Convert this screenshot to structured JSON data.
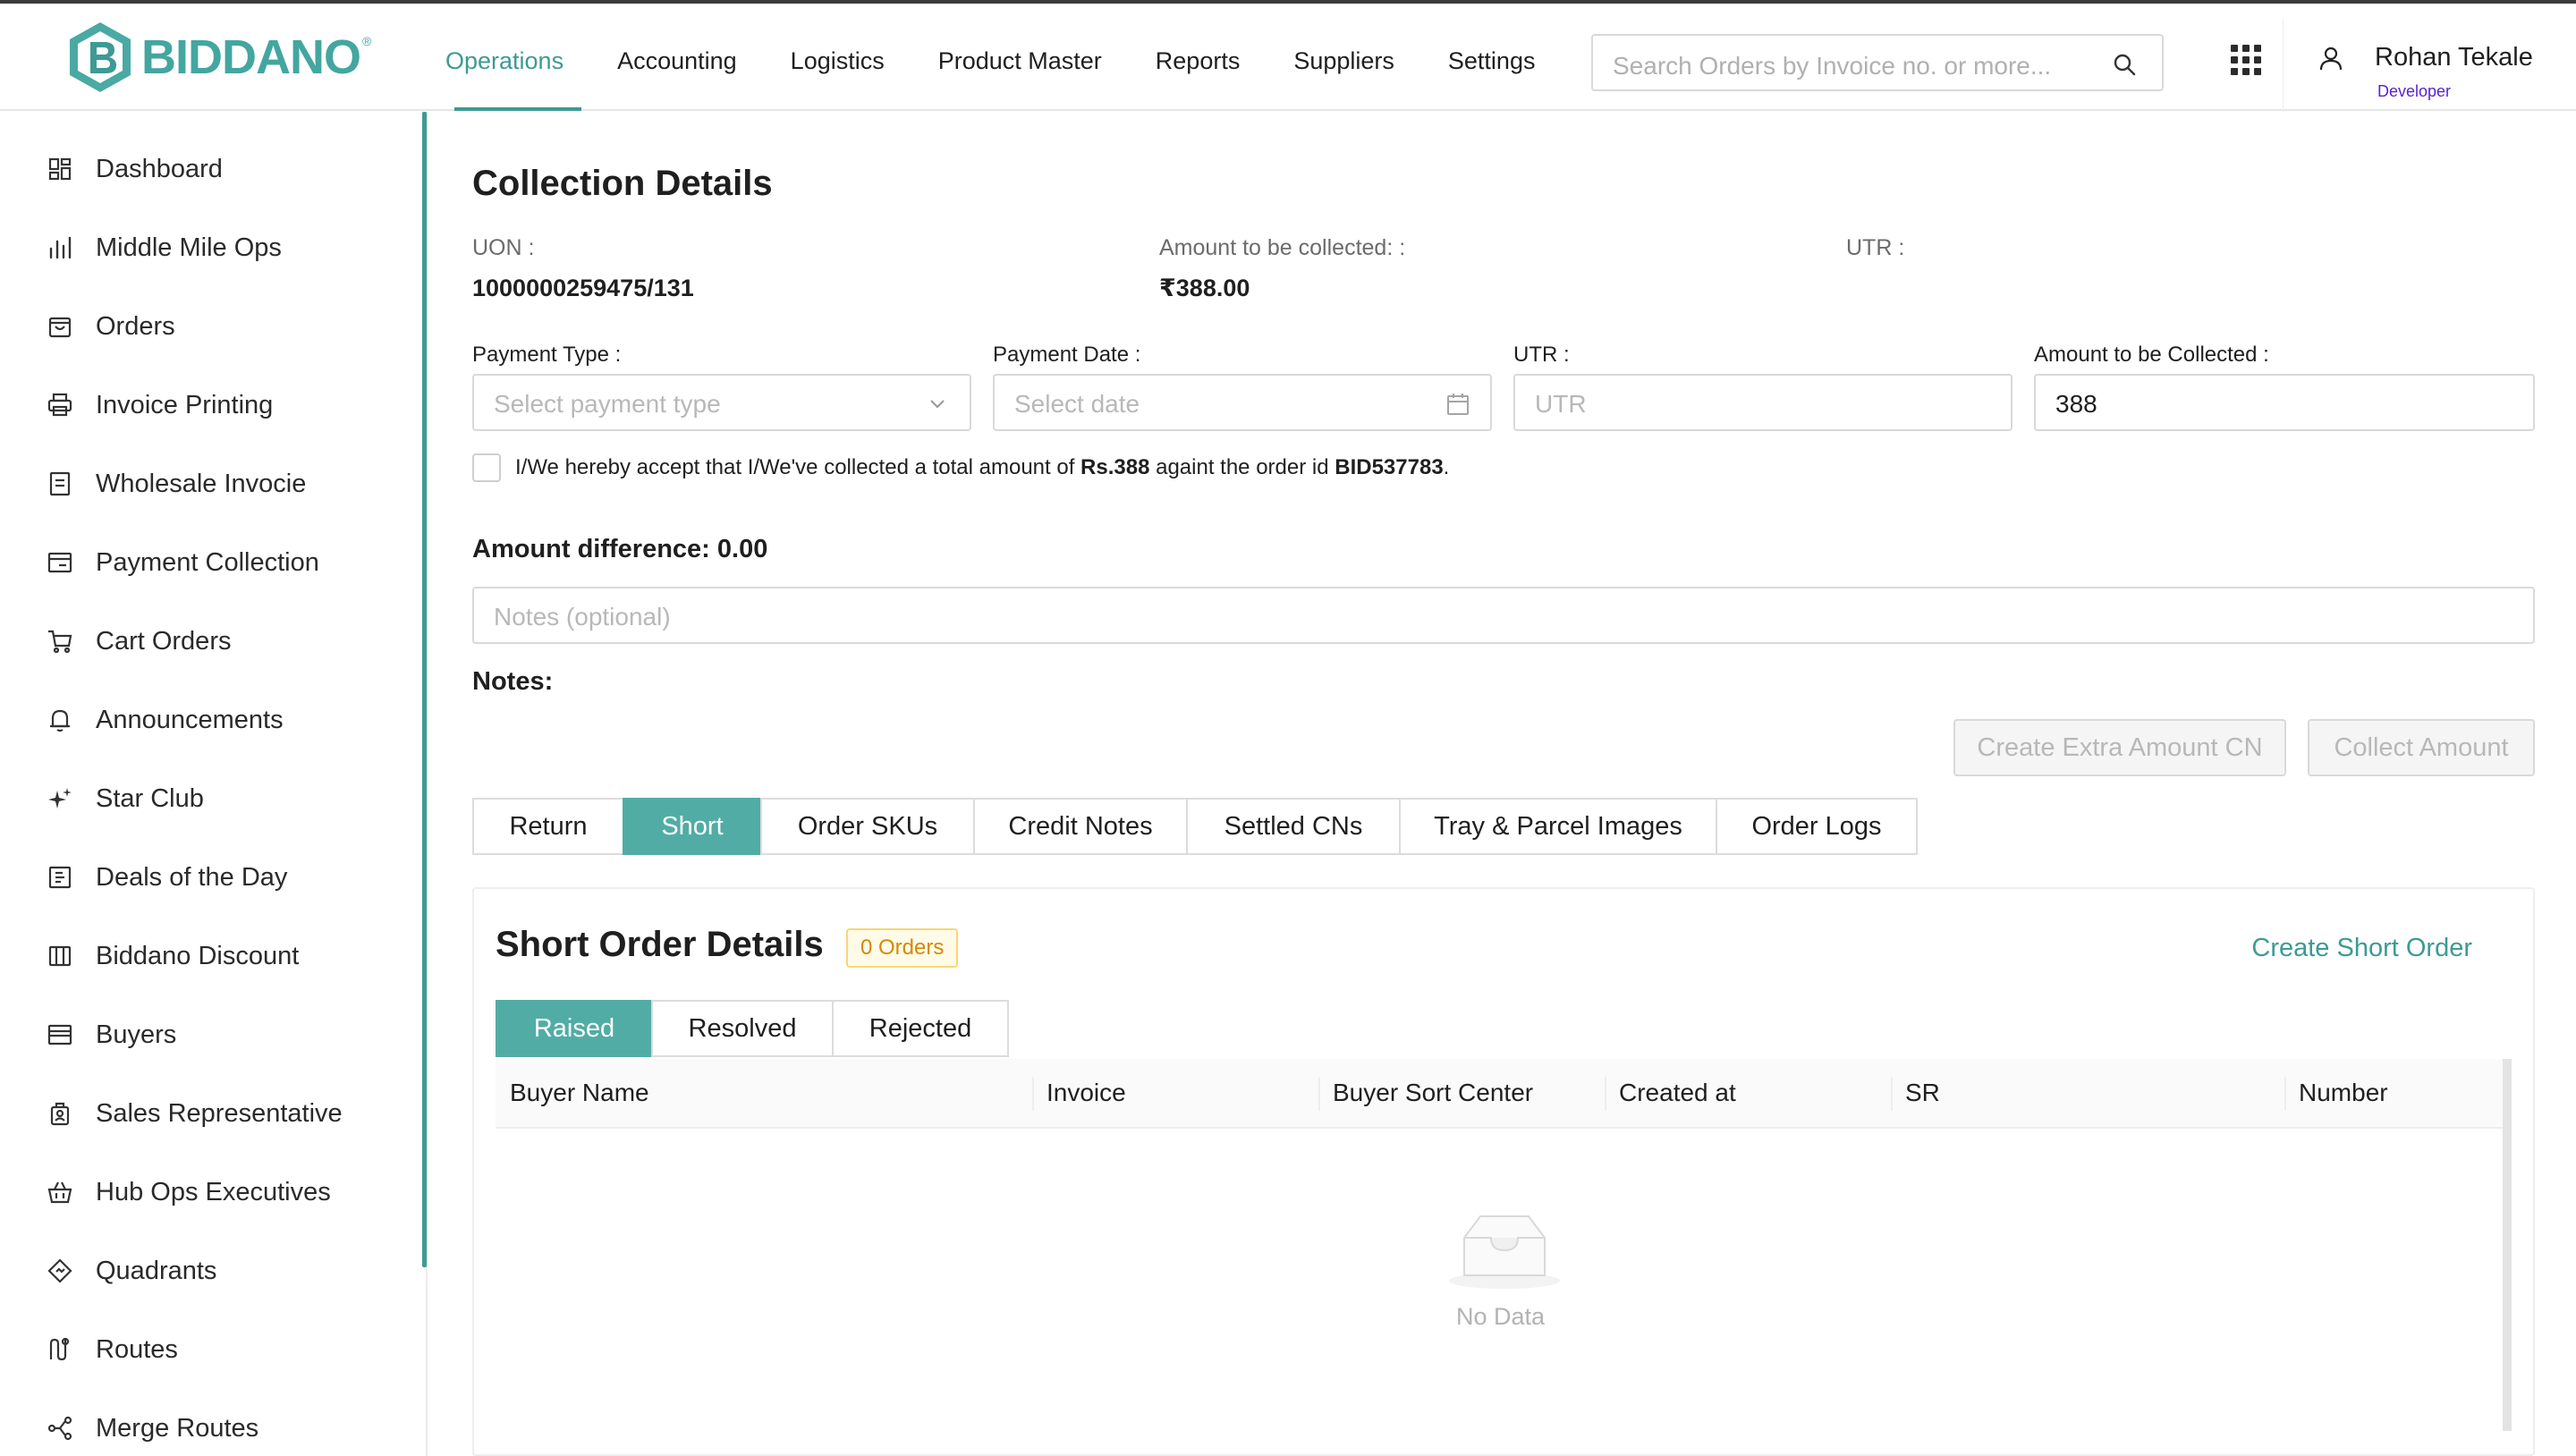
{
  "brand": {
    "name": "BIDDANO",
    "reg": "®"
  },
  "topnav": [
    "Operations",
    "Accounting",
    "Logistics",
    "Product Master",
    "Reports",
    "Suppliers",
    "Settings"
  ],
  "search": {
    "placeholder": "Search Orders by Invoice no. or more..."
  },
  "user": {
    "name": "Rohan Tekale",
    "role": "Developer"
  },
  "sidebar": [
    {
      "label": "Dashboard",
      "icon": "dashboard-icon"
    },
    {
      "label": "Middle Mile Ops",
      "icon": "bar-chart-icon"
    },
    {
      "label": "Orders",
      "icon": "bag-icon"
    },
    {
      "label": "Invoice Printing",
      "icon": "printer-icon"
    },
    {
      "label": "Wholesale Invocie",
      "icon": "document-icon"
    },
    {
      "label": "Payment Collection",
      "icon": "wallet-icon"
    },
    {
      "label": "Cart Orders",
      "icon": "cart-icon"
    },
    {
      "label": "Announcements",
      "icon": "bell-icon"
    },
    {
      "label": "Star Club",
      "icon": "sparkle-icon"
    },
    {
      "label": "Deals of the Day",
      "icon": "deal-icon"
    },
    {
      "label": "Biddano Discount",
      "icon": "discount-icon"
    },
    {
      "label": "Buyers",
      "icon": "store-icon"
    },
    {
      "label": "Sales Representative",
      "icon": "person-badge-icon"
    },
    {
      "label": "Hub Ops Executives",
      "icon": "basket-icon"
    },
    {
      "label": "Quadrants",
      "icon": "diamond-icon"
    },
    {
      "label": "Routes",
      "icon": "route-icon"
    },
    {
      "label": "Merge Routes",
      "icon": "merge-icon"
    }
  ],
  "collection": {
    "title": "Collection Details",
    "uon_label": "UON :",
    "uon_value": "1000000259475/131",
    "amount_label": "Amount to be collected: :",
    "amount_value": "₹388.00",
    "utr_label": "UTR :",
    "payment_type_label": "Payment Type :",
    "payment_type_placeholder": "Select payment type",
    "payment_date_label": "Payment Date :",
    "payment_date_placeholder": "Select date",
    "utr_field_label": "UTR :",
    "utr_placeholder": "UTR",
    "amount_field_label": "Amount to be Collected :",
    "amount_field_value": "388",
    "accept_prefix": "I/We hereby accept that I/We've collected a total amount of ",
    "accept_amount": "Rs.388",
    "accept_mid": " againt the order id ",
    "accept_order": "BID537783",
    "accept_suffix": ".",
    "amount_difference": "Amount difference: 0.00",
    "notes_placeholder": "Notes (optional)",
    "notes_label": "Notes:",
    "btn_extra_cn": "Create Extra Amount CN",
    "btn_collect": "Collect Amount"
  },
  "tabs": [
    "Return",
    "Short",
    "Order SKUs",
    "Credit Notes",
    "Settled CNs",
    "Tray & Parcel Images",
    "Order Logs"
  ],
  "active_tab": "Short",
  "short_orders": {
    "title": "Short Order Details",
    "badge": "0 Orders",
    "create_link": "Create Short Order",
    "subtabs": [
      "Raised",
      "Resolved",
      "Rejected"
    ],
    "active_subtab": "Raised",
    "columns": [
      "Buyer Name",
      "Invoice",
      "Buyer Sort Center",
      "Created at",
      "SR",
      "Number"
    ],
    "empty_text": "No Data"
  },
  "colors": {
    "accent": "#3d9a94",
    "tab_active": "#52aca6",
    "role": "#5b21d6",
    "badge": "#d48806"
  }
}
